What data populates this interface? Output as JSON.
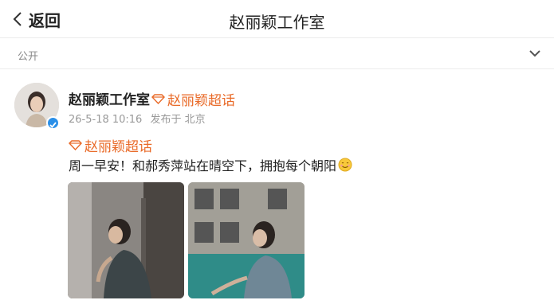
{
  "nav": {
    "back_label": "返回",
    "title": "赵丽颖工作室"
  },
  "visibility": {
    "label": "公开"
  },
  "post": {
    "author": "赵丽颖工作室",
    "super_topic": "赵丽颖超话",
    "timestamp": "26-5-18 10:16",
    "source": "发布于 北京",
    "content_tag": "赵丽颖超话",
    "text": "周一早安！和郝秀萍站在晴空下，拥抱每个朝阳",
    "emoji": "smiling-face-icon",
    "images": [
      "photo-woman-leaning-at-door",
      "photo-woman-by-building"
    ]
  },
  "colors": {
    "accent_orange": "#e96a28",
    "verified_blue": "#2a8fe8"
  }
}
